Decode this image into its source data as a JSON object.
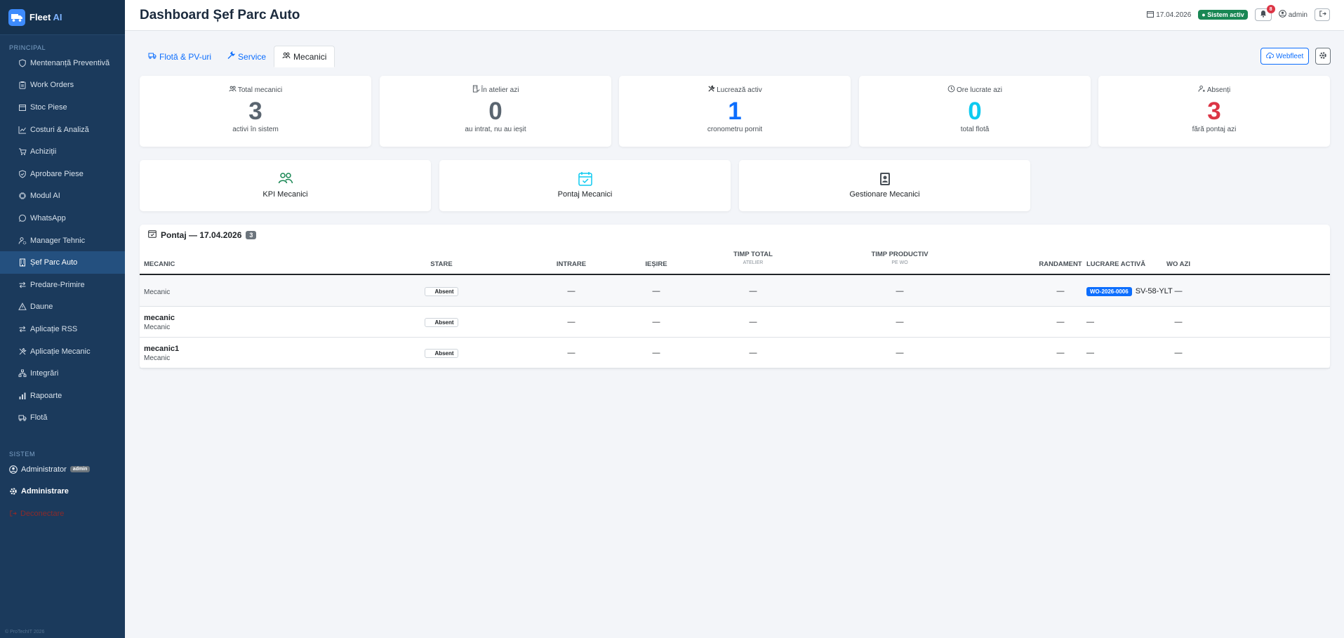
{
  "sidebar": {
    "brand_name": "Fleet",
    "brand_suffix": "AI",
    "section_principal": "PRINCIPAL",
    "items": [
      {
        "label": "Mentenanță Preventivă",
        "icon": "shield-icon"
      },
      {
        "label": "Work Orders",
        "icon": "clipboard-icon"
      },
      {
        "label": "Stoc Piese",
        "icon": "box-icon"
      },
      {
        "label": "Costuri & Analiză",
        "icon": "chart-line-icon"
      },
      {
        "label": "Achiziții",
        "icon": "cart-icon"
      },
      {
        "label": "Aprobare Piese",
        "icon": "shield-check-icon"
      },
      {
        "label": "Modul AI",
        "icon": "cpu-icon"
      },
      {
        "label": "WhatsApp",
        "icon": "whatsapp-icon"
      },
      {
        "label": "Manager Tehnic",
        "icon": "person-gear-icon"
      },
      {
        "label": "Șef Parc Auto",
        "icon": "building-icon",
        "active": true
      },
      {
        "label": "Predare-Primire",
        "icon": "arrows-swap-icon"
      },
      {
        "label": "Daune",
        "icon": "warning-icon"
      },
      {
        "label": "Aplicație RSS",
        "icon": "arrows-swap-icon"
      },
      {
        "label": "Aplicație Mecanic",
        "icon": "tools-icon"
      },
      {
        "label": "Integrări",
        "icon": "diagram-icon"
      },
      {
        "label": "Rapoarte",
        "icon": "bar-chart-icon"
      },
      {
        "label": "Flotă",
        "icon": "truck-icon"
      }
    ],
    "section_sistem": "SISTEM",
    "user_label": "Administrator",
    "user_badge": "admin",
    "admin_label": "Administrare",
    "logout_label": "Deconectare",
    "footer": "© ProTechIT 2026"
  },
  "header": {
    "title": "Dashboard Șef Parc Auto",
    "date": "17.04.2026",
    "status": "Sistem activ",
    "notifications": "8",
    "user": "admin"
  },
  "tabs": [
    {
      "label": "Flotă & PV-uri",
      "active": false
    },
    {
      "label": "Service",
      "active": false
    },
    {
      "label": "Mecanici",
      "active": true
    }
  ],
  "webfleet_label": "Webfleet",
  "stats": [
    {
      "label": "Total mecanici",
      "value": "3",
      "sub": "activi în sistem",
      "color": "#5a6570"
    },
    {
      "label": "În atelier azi",
      "value": "0",
      "sub": "au intrat, nu au ieșit",
      "color": "#5a6570"
    },
    {
      "label": "Lucrează activ",
      "value": "1",
      "sub": "cronometru pornit",
      "color": "#0d6efd"
    },
    {
      "label": "Ore lucrate azi",
      "value": "0",
      "sub": "total flotă",
      "color": "#0dcaf0"
    },
    {
      "label": "Absenți",
      "value": "3",
      "sub": "fără pontaj azi",
      "color": "#dc3545"
    }
  ],
  "actions": [
    {
      "label": "KPI Mecanici",
      "color": "#198754"
    },
    {
      "label": "Pontaj Mecanici",
      "color": "#0dcaf0"
    },
    {
      "label": "Gestionare Mecanici",
      "color": "#495057"
    }
  ],
  "pontaj": {
    "title": "Pontaj — 17.04.2026",
    "count": "3",
    "columns": {
      "mecanic": "MECANIC",
      "stare": "STARE",
      "intrare": "INTRARE",
      "iesire": "IEȘIRE",
      "timp_total": "TIMP TOTAL",
      "timp_total_sub": "ATELIER",
      "timp_productiv": "TIMP PRODUCTIV",
      "timp_productiv_sub": "PE WO",
      "randament": "RANDAMENT",
      "wo_azi": "WO AZI",
      "lucrare": "LUCRARE ACTIVĂ"
    },
    "rows": [
      {
        "name": "",
        "role": "Mecanic",
        "status": "Absent",
        "intrare": "—",
        "iesire": "—",
        "timp_total": "—",
        "timp_productiv": "—",
        "randament": "—",
        "wo_azi": "—",
        "wo": "WO-2026-0006",
        "plate": "SV-58-YLT"
      },
      {
        "name": "mecanic",
        "role": "Mecanic",
        "status": "Absent",
        "intrare": "—",
        "iesire": "—",
        "timp_total": "—",
        "timp_productiv": "—",
        "randament": "—",
        "wo_azi": "—",
        "lucrare": "—"
      },
      {
        "name": "mecanic1",
        "role": "Mecanic",
        "status": "Absent",
        "intrare": "—",
        "iesire": "—",
        "timp_total": "—",
        "timp_productiv": "—",
        "randament": "—",
        "wo_azi": "—",
        "lucrare": "—"
      }
    ]
  }
}
